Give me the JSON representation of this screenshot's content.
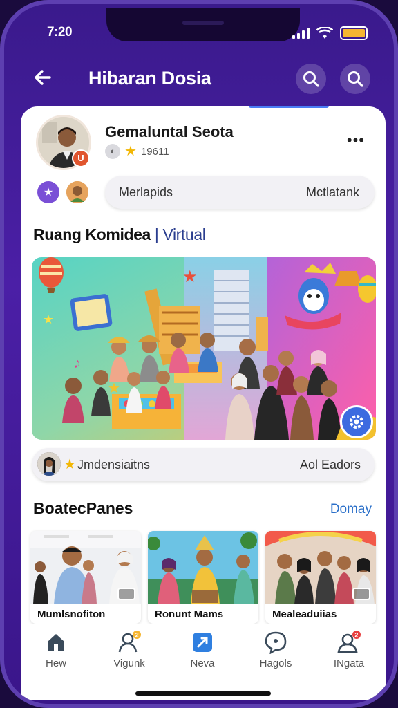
{
  "status_bar": {
    "time": "7:20",
    "battery_color": "#f5b531"
  },
  "header": {
    "title": "Hibaran Dosia"
  },
  "profile": {
    "name": "Gemaluntal Seota",
    "meta": "19611",
    "avatar_badge": "U"
  },
  "filter_pill": {
    "left": "Merlapids",
    "right": "Mctlatank"
  },
  "section_title": {
    "main": "Ruang Komidea",
    "separator": " | ",
    "accent": "Virtual"
  },
  "info_pill": {
    "left": "Jmdensiaitns",
    "right": "Aol Eadors"
  },
  "recommend": {
    "title": "BoatecPanes",
    "see_more": "Domay",
    "items": [
      {
        "caption": "Mumlsnofiton"
      },
      {
        "caption": "Ronunt Mams"
      },
      {
        "caption": "Mealeaduiias"
      }
    ]
  },
  "bottom_nav": [
    {
      "label": "Hew",
      "icon": "home-icon"
    },
    {
      "label": "Vigunk",
      "icon": "people-icon"
    },
    {
      "label": "Neva",
      "icon": "new-icon"
    },
    {
      "label": "Hagols",
      "icon": "chat-icon"
    },
    {
      "label": "INgata",
      "icon": "profile-icon"
    }
  ],
  "colors": {
    "brand_purple": "#4b1fa6",
    "accent_blue": "#3d6be0",
    "link_blue": "#2a6fc9"
  }
}
